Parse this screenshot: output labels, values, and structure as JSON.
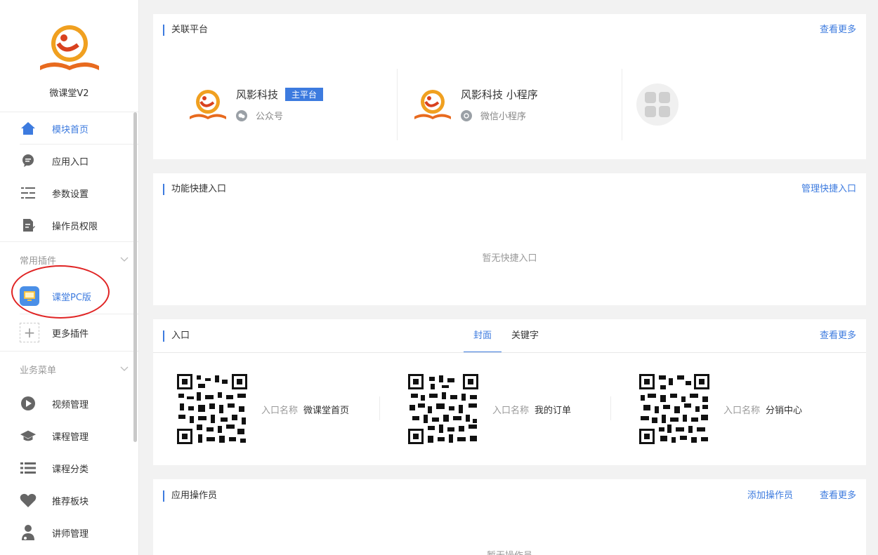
{
  "app": {
    "name": "微课堂V2"
  },
  "nav": {
    "items": [
      {
        "label": "模块首页",
        "icon": "home-icon"
      },
      {
        "label": "应用入口",
        "icon": "chat-icon"
      },
      {
        "label": "参数设置",
        "icon": "settings-list-icon"
      },
      {
        "label": "操作员权限",
        "icon": "document-edit-icon"
      }
    ],
    "plugins_group": "常用插件",
    "plugin_item": "课堂PC版",
    "more_plugins": "更多插件",
    "business_group": "业务菜单",
    "business_items": [
      {
        "label": "视频管理",
        "icon": "play-icon"
      },
      {
        "label": "课程管理",
        "icon": "graduation-cap-icon"
      },
      {
        "label": "课程分类",
        "icon": "list-icon"
      },
      {
        "label": "推荐板块",
        "icon": "heart-icon"
      },
      {
        "label": "讲师管理",
        "icon": "teacher-icon"
      }
    ]
  },
  "platform_card": {
    "title": "关联平台",
    "link": "查看更多",
    "items": [
      {
        "name": "风影科技",
        "tag": "主平台",
        "type": "公众号"
      },
      {
        "name": "风影科技 小程序",
        "type": "微信小程序"
      }
    ]
  },
  "shortcut_card": {
    "title": "功能快捷入口",
    "link": "管理快捷入口",
    "empty": "暂无快捷入口"
  },
  "entry_card": {
    "title": "入口",
    "tabs": [
      "封面",
      "关键字"
    ],
    "link": "查看更多",
    "key_label": "入口名称",
    "entries": [
      "微课堂首页",
      "我的订单",
      "分销中心"
    ]
  },
  "operator_card": {
    "title": "应用操作员",
    "add_link": "添加操作员",
    "link": "查看更多",
    "empty": "暂无操作员"
  },
  "colors": {
    "accent": "#3d7bdf",
    "highlight_circle": "#e02424"
  }
}
